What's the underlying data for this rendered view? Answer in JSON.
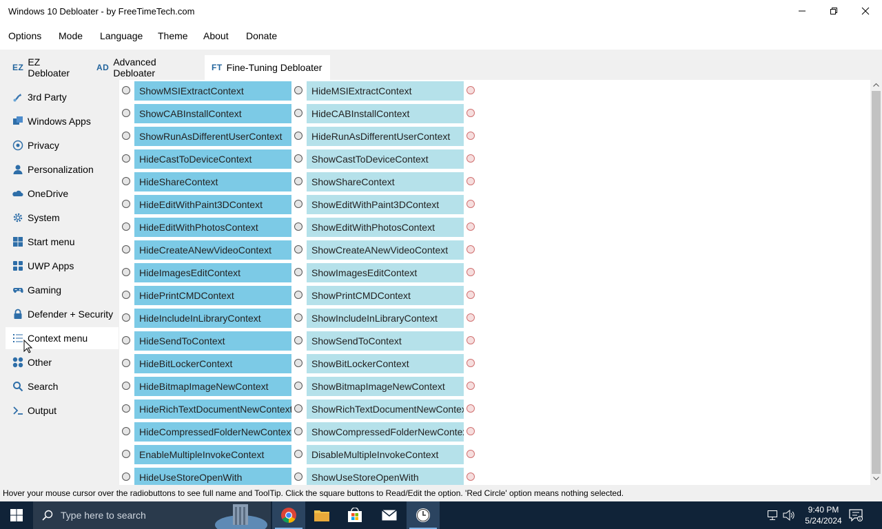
{
  "window": {
    "title": "Windows 10 Debloater - by FreeTimeTech.com"
  },
  "menu": [
    "Options",
    "Mode",
    "Language",
    "Theme",
    "About",
    "Donate"
  ],
  "tabs": [
    {
      "abbr": "EZ",
      "label": "EZ Debloater"
    },
    {
      "abbr": "AD",
      "label": "Advanced Debloater"
    },
    {
      "abbr": "FT",
      "label": "Fine-Tuning Debloater"
    }
  ],
  "active_tab": 2,
  "sidebar": {
    "active": 11,
    "items": [
      {
        "label": "3rd Party",
        "icon": "3rd-party-icon"
      },
      {
        "label": "Windows Apps",
        "icon": "windows-apps-icon"
      },
      {
        "label": "Privacy",
        "icon": "privacy-icon"
      },
      {
        "label": "Personalization",
        "icon": "personalization-icon"
      },
      {
        "label": "OneDrive",
        "icon": "onedrive-icon"
      },
      {
        "label": "System",
        "icon": "gear-icon"
      },
      {
        "label": "Start menu",
        "icon": "start-menu-icon"
      },
      {
        "label": "UWP Apps",
        "icon": "uwp-apps-icon"
      },
      {
        "label": "Gaming",
        "icon": "gamepad-icon"
      },
      {
        "label": "Defender + Security",
        "icon": "lock-icon"
      },
      {
        "label": "Context menu",
        "icon": "list-icon"
      },
      {
        "label": "Other",
        "icon": "other-icon"
      },
      {
        "label": "Search",
        "icon": "search-icon"
      },
      {
        "label": "Output",
        "icon": "terminal-icon"
      }
    ]
  },
  "options": [
    {
      "a": "ShowMSIExtractContext",
      "b": "HideMSIExtractContext"
    },
    {
      "a": "ShowCABInstallContext",
      "b": "HideCABInstallContext"
    },
    {
      "a": "ShowRunAsDifferentUserContext",
      "b": "HideRunAsDifferentUserContext"
    },
    {
      "a": "HideCastToDeviceContext",
      "b": "ShowCastToDeviceContext"
    },
    {
      "a": "HideShareContext",
      "b": "ShowShareContext"
    },
    {
      "a": "HideEditWithPaint3DContext",
      "b": "ShowEditWithPaint3DContext"
    },
    {
      "a": "HideEditWithPhotosContext",
      "b": "ShowEditWithPhotosContext"
    },
    {
      "a": "HideCreateANewVideoContext",
      "b": "ShowCreateANewVideoContext"
    },
    {
      "a": "HideImagesEditContext",
      "b": "ShowImagesEditContext"
    },
    {
      "a": "HidePrintCMDContext",
      "b": "ShowPrintCMDContext"
    },
    {
      "a": "HideIncludeInLibraryContext",
      "b": "ShowIncludeInLibraryContext"
    },
    {
      "a": "HideSendToContext",
      "b": "ShowSendToContext"
    },
    {
      "a": "HideBitLockerContext",
      "b": "ShowBitLockerContext"
    },
    {
      "a": "HideBitmapImageNewContext",
      "b": "ShowBitmapImageNewContext"
    },
    {
      "a": "HideRichTextDocumentNewContext",
      "b": "ShowRichTextDocumentNewContex"
    },
    {
      "a": "HideCompressedFolderNewContext",
      "b": "ShowCompressedFolderNewContex"
    },
    {
      "a": "EnableMultipleInvokeContext",
      "b": "DisableMultipleInvokeContext"
    },
    {
      "a": "HideUseStoreOpenWith",
      "b": "ShowUseStoreOpenWith"
    }
  ],
  "status": {
    "text": "Hover your mouse cursor over the radiobuttons to see full name and ToolTip. Click the square buttons to Read/Edit the option. 'Red Circle' option means nothing selected."
  },
  "taskbar": {
    "search_placeholder": "Type here to search",
    "apps": [
      "chrome-icon",
      "file-explorer-icon",
      "store-icon",
      "mail-icon",
      "clock-app-icon"
    ],
    "time": "9:40 PM",
    "date": "5/24/2024"
  },
  "colors": {
    "option_a": "#7ccae6",
    "option_b": "#b5e1ea",
    "accent": "#23659d",
    "taskbar": "#102338"
  }
}
